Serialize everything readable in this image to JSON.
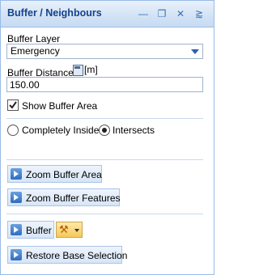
{
  "window": {
    "title": "Buffer / Neighbours"
  },
  "titlebar_icons": [
    "minimize-icon",
    "restore-icon",
    "close-icon",
    "pin-icon"
  ],
  "buffer_layer": {
    "label": "Buffer Layer",
    "value": "Emergency"
  },
  "buffer_distance": {
    "label": "Buffer Distance",
    "unit": "[m]",
    "value": "150.00"
  },
  "show_buffer_area": {
    "label": "Show Buffer Area",
    "checked": true
  },
  "mode": {
    "option_inside": "Completely Inside",
    "option_intersects": "Intersects",
    "selected": "Intersects"
  },
  "buttons": {
    "zoom_area": "Zoom Buffer Area",
    "zoom_features": "Zoom Buffer Features",
    "buffer": "Buffer",
    "restore": "Restore Base Selection"
  }
}
